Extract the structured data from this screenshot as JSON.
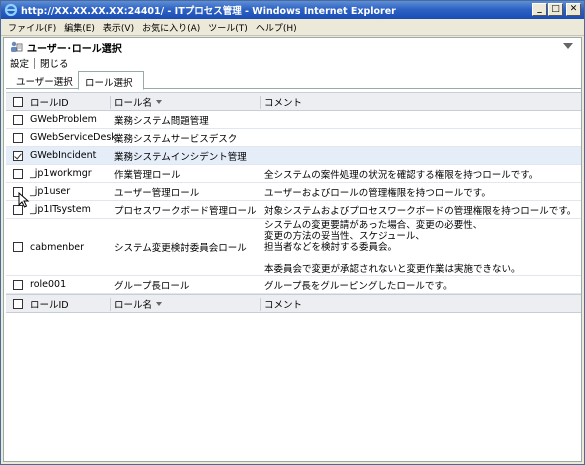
{
  "window": {
    "title": "http://XX.XX.XX.XX:24401/ - ITプロセス管理 - Windows Internet Explorer",
    "min_label": "_",
    "max_label": "□",
    "close_label": "✕"
  },
  "menu": [
    "ファイル(F)",
    "編集(E)",
    "表示(V)",
    "お気に入り(A)",
    "ツール(T)",
    "ヘルプ(H)"
  ],
  "page": {
    "title": "ユーザー･ロール選択",
    "toolbar": {
      "settings": "設定",
      "close": "閉じる"
    },
    "tabs": [
      {
        "label": "ユーザー選択",
        "active": false
      },
      {
        "label": "ロール選択",
        "active": true
      }
    ]
  },
  "table": {
    "headers": {
      "id": "ロールID",
      "name": "ロール名",
      "desc": "コメント"
    },
    "rows": [
      {
        "checked": false,
        "id": "GWebProblem",
        "name": "業務システム問題管理",
        "desc": ""
      },
      {
        "checked": false,
        "id": "GWebServiceDesk",
        "name": "業務システムサービスデスク",
        "desc": ""
      },
      {
        "checked": true,
        "id": "GWebIncident",
        "name": "業務システムインシデント管理",
        "desc": ""
      },
      {
        "checked": false,
        "id": "_jp1workmgr",
        "name": "作業管理ロール",
        "desc": "全システムの案件処理の状況を確認する権限を持つロールです。"
      },
      {
        "checked": false,
        "id": "_jp1user",
        "name": "ユーザー管理ロール",
        "desc": "ユーザーおよびロールの管理権限を持つロールです。"
      },
      {
        "checked": false,
        "id": "_jp1ITsystem",
        "name": "プロセスワークボード管理ロール",
        "desc": "対象システムおよびプロセスワークボードの管理権限を持つロールです。"
      },
      {
        "checked": false,
        "id": "cabmenber",
        "name": "システム変更検討委員会ロール",
        "desc_lines": [
          "システムの変更要請があった場合、変更の必要性、",
          "変更の方法の妥当性、スケジュール、",
          "担当者などを検討する委員会。",
          "",
          "本委員会で変更が承認されないと変更作業は実施できない。"
        ]
      },
      {
        "checked": false,
        "id": "role001",
        "name": "グループ長ロール",
        "desc": "グループ長をグルーピングしたロールです。"
      }
    ],
    "footer": {
      "id": "ロールID",
      "name": "ロール名",
      "desc": "コメント"
    }
  }
}
